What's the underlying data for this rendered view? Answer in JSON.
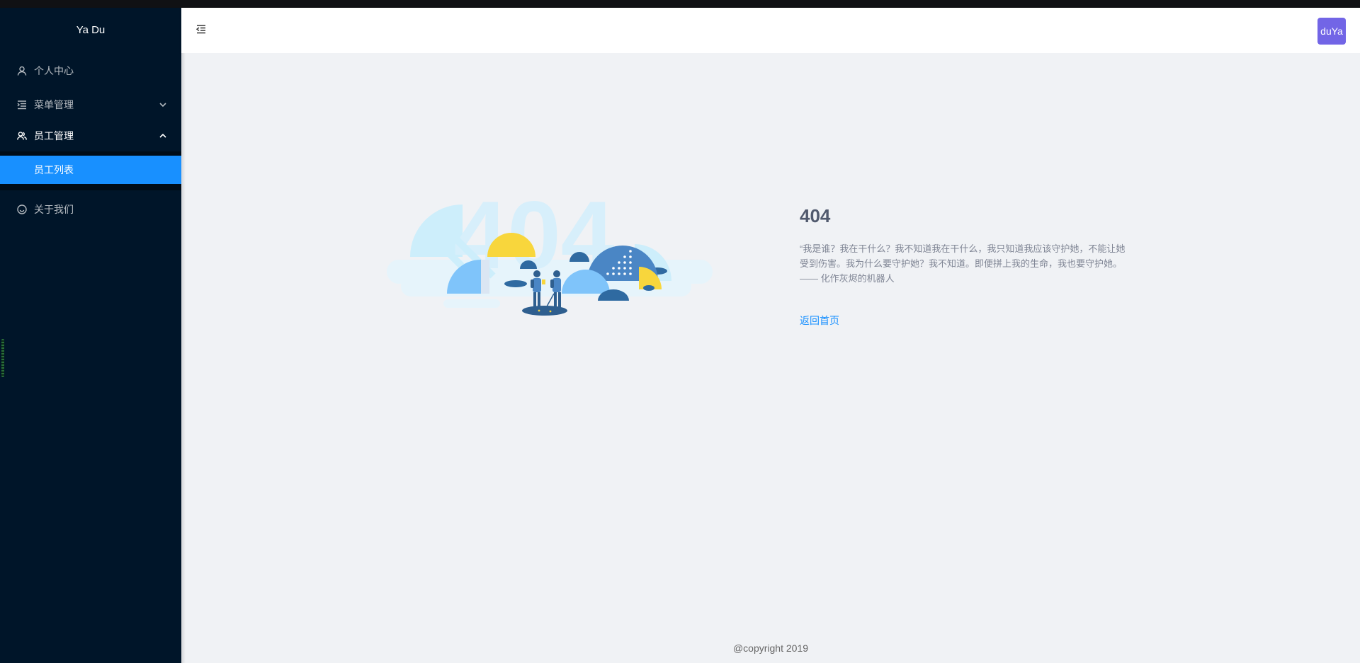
{
  "app": {
    "brand": "Ya Du"
  },
  "sidebar": {
    "items": [
      {
        "label": "个人中心",
        "icon": "user-icon"
      },
      {
        "label": "菜单管理",
        "icon": "menu-list-icon",
        "expanded": false
      },
      {
        "label": "员工管理",
        "icon": "team-icon",
        "expanded": true,
        "children": [
          {
            "label": "员工列表",
            "selected": true
          }
        ]
      },
      {
        "label": "关于我们",
        "icon": "smile-icon"
      }
    ]
  },
  "header": {
    "fold_icon": "menu-fold-icon",
    "avatar_text": "duYa"
  },
  "error_page": {
    "illustration_text": "404",
    "title": "404",
    "desc_lines": [
      "“我是谁？我在干什么？我不知道我在干什么，我只知道我应该守护她，不能让她",
      "受到伤害。我为什么要守护她？我不知道。即便拼上我的生命，我也要守护她。",
      "—— 化作灰烬的机器人"
    ],
    "back_link": "返回首页"
  },
  "footer": {
    "copyright": "@copyright 2019"
  },
  "colors": {
    "sidebar_bg": "#001529",
    "accent": "#1890ff",
    "avatar_bg": "#7265e6",
    "content_bg": "#f0f2f5"
  }
}
